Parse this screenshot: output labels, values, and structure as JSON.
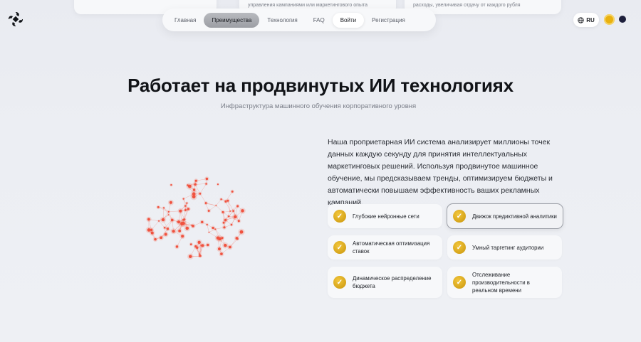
{
  "top_cards": {
    "left": "",
    "middle": "управления кампаниями или маркетингового опыта",
    "right": "расходы, увеличивая отдачу от каждого рубля"
  },
  "nav": {
    "items": [
      {
        "label": "Главная"
      },
      {
        "label": "Преимущества",
        "active": true
      },
      {
        "label": "Технология"
      },
      {
        "label": "FAQ"
      },
      {
        "label": "Войти"
      },
      {
        "label": "Регистрация"
      }
    ]
  },
  "language": {
    "label": "RU",
    "icon": "globe-icon"
  },
  "theme": {
    "light_color": "#e9b10f",
    "dark_color": "#1d1f3b"
  },
  "section": {
    "title": "Работает на продвинутых ИИ технологиях",
    "subtitle": "Инфраструктура машинного обучения корпоративного уровня",
    "description": "Наша проприетарная ИИ система анализирует миллионы точек данных каждую секунду для принятия интеллектуальных маркетинговых решений. Используя продвинутое машинное обучение, мы предсказываем тренды, оптимизируем бюджеты и автоматически повышаем эффективность ваших рекламных кампаний."
  },
  "features": [
    {
      "label": "Глубокие нейронные сети"
    },
    {
      "label": "Движок предиктивной аналитики"
    },
    {
      "label": "Автоматическая оптимизация ставок"
    },
    {
      "label": "Умный таргетинг аудитории"
    },
    {
      "label": "Динамическое распределение бюджета"
    },
    {
      "label": "Отслеживание производительности в реальном времени"
    }
  ],
  "colors": {
    "accent": "#e9b10f",
    "network": "#f0523f"
  }
}
